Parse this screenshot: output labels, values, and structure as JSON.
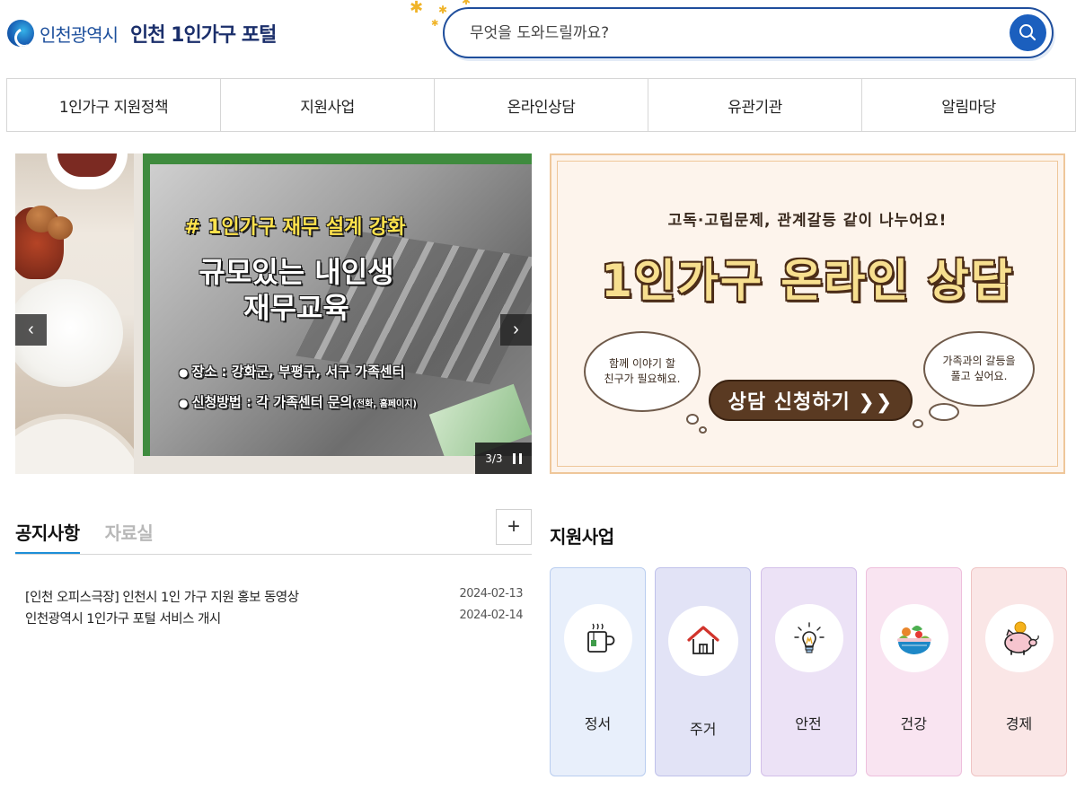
{
  "header": {
    "city_name": "인천광역시",
    "portal_name": "인천 1인가구 포털",
    "search_placeholder": "무엇을 도와드릴까요?"
  },
  "nav": {
    "items": [
      {
        "label": "1인가구 지원정책"
      },
      {
        "label": "지원사업"
      },
      {
        "label": "온라인상담"
      },
      {
        "label": "유관기관"
      },
      {
        "label": "알림마당"
      }
    ]
  },
  "slider": {
    "tag": "# 1인가구 재무 설계 강화",
    "title_line1": "규모있는 내인생",
    "title_line2": "재무교육",
    "bullet1": "장소 : 강화군, 부평구, 서구 가족센터",
    "bullet2": "신청방법 : 각 가족센터 문의",
    "bullet2_note": "(전화, 홈페이지)",
    "counter": "3/3",
    "prev_symbol": "‹",
    "next_symbol": "›"
  },
  "counsel_banner": {
    "subtitle": "고독·고립문제, 관계갈등 같이 나누어요!",
    "title": "1인가구 온라인 상담",
    "bubble_left_line1": "함께 이야기 할",
    "bubble_left_line2": "친구가 필요해요.",
    "bubble_right_line1": "가족과의 갈등을",
    "bubble_right_line2": "풀고 싶어요.",
    "button_label": "상담 신청하기 ❯❯"
  },
  "notice": {
    "tabs": [
      {
        "label": "공지사항",
        "active": true
      },
      {
        "label": "자료실",
        "active": false
      }
    ],
    "more_label": "+",
    "items": [
      {
        "title": "[인천 오피스극장] 인천시 1인 가구 지원 홍보 동영상",
        "date": "2024-02-13"
      },
      {
        "title": "인천광역시 1인가구 포털 서비스 개시",
        "date": "2024-02-14"
      }
    ]
  },
  "support": {
    "title": "지원사업",
    "cards": [
      {
        "label": "정서",
        "icon": "tea-cup-icon",
        "bg": "#e8effb",
        "border": "#b9cdef"
      },
      {
        "label": "주거",
        "icon": "house-icon",
        "bg": "#e2e3f6",
        "border": "#bfc1ea"
      },
      {
        "label": "안전",
        "icon": "lightbulb-icon",
        "bg": "#ece2f6",
        "border": "#d3bfe9"
      },
      {
        "label": "건강",
        "icon": "salad-bowl-icon",
        "bg": "#f9e4f1",
        "border": "#eebfdc"
      },
      {
        "label": "경제",
        "icon": "piggy-bank-icon",
        "bg": "#fae6e6",
        "border": "#efc4c4"
      }
    ]
  },
  "colors": {
    "brand_blue": "#1f4e9c",
    "tab_accent": "#1d8fd8",
    "counsel_brown": "#5a3a22"
  }
}
